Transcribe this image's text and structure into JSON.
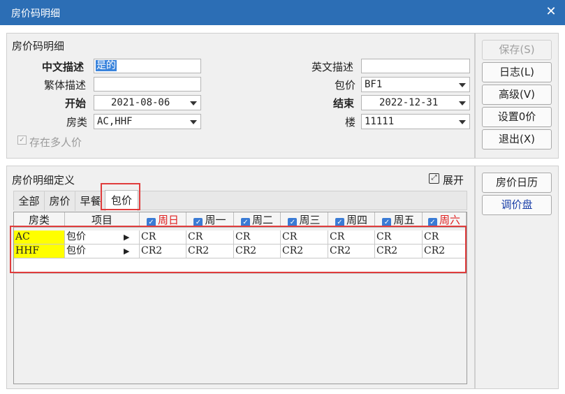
{
  "window": {
    "title": "房价码明细",
    "close_glyph": "✕"
  },
  "section1": {
    "title": "房价码明细",
    "cn_desc_label": "中文描述",
    "cn_desc_value": "是的",
    "trad_desc_label": "繁体描述",
    "trad_desc_value": "",
    "start_label": "开始",
    "start_value": "2021-08-06",
    "room_type_label": "房类",
    "room_type_value": "AC,HHF",
    "en_desc_label": "英文描述",
    "en_desc_value": "",
    "package_label": "包价",
    "package_value": "BF1",
    "end_label": "结束",
    "end_value": "2022-12-31",
    "building_label": "楼",
    "building_value": "11111",
    "multi_price_label": "存在多人价",
    "multi_price_checked": true
  },
  "buttons": {
    "save": "保存(S)",
    "log": "日志(L)",
    "advanced": "高级(V)",
    "set_zero": "设置0价",
    "exit": "退出(X)",
    "rate_calendar": "房价日历",
    "rate_adjust": "调价盘"
  },
  "section2": {
    "title": "房价明细定义",
    "expand_label": "展开",
    "tabs": [
      "全部",
      "房价",
      "早餐",
      "包价"
    ],
    "active_tab": "包价",
    "columns": {
      "room_type": "房类",
      "item": "项目",
      "sun": "周日",
      "mon": "周一",
      "tue": "周二",
      "wed": "周三",
      "thu": "周四",
      "fri": "周五",
      "sat": "周六"
    },
    "rows": [
      {
        "room": "AC",
        "item": "包价",
        "arrow": "▶",
        "sun": "CR",
        "mon": "CR",
        "tue": "CR",
        "wed": "CR",
        "thu": "CR",
        "fri": "CR",
        "sat": "CR"
      },
      {
        "room": "HHF",
        "item": "包价",
        "arrow": "▶",
        "sun": "CR2",
        "mon": "CR2",
        "tue": "CR2",
        "wed": "CR2",
        "thu": "CR2",
        "fri": "CR2",
        "sat": "CR2"
      }
    ]
  },
  "colors": {
    "titlebar": "#2c6eb5",
    "highlight": "#ffff00",
    "weekend": "#e02020",
    "annotation_box": "#e03c3c"
  }
}
